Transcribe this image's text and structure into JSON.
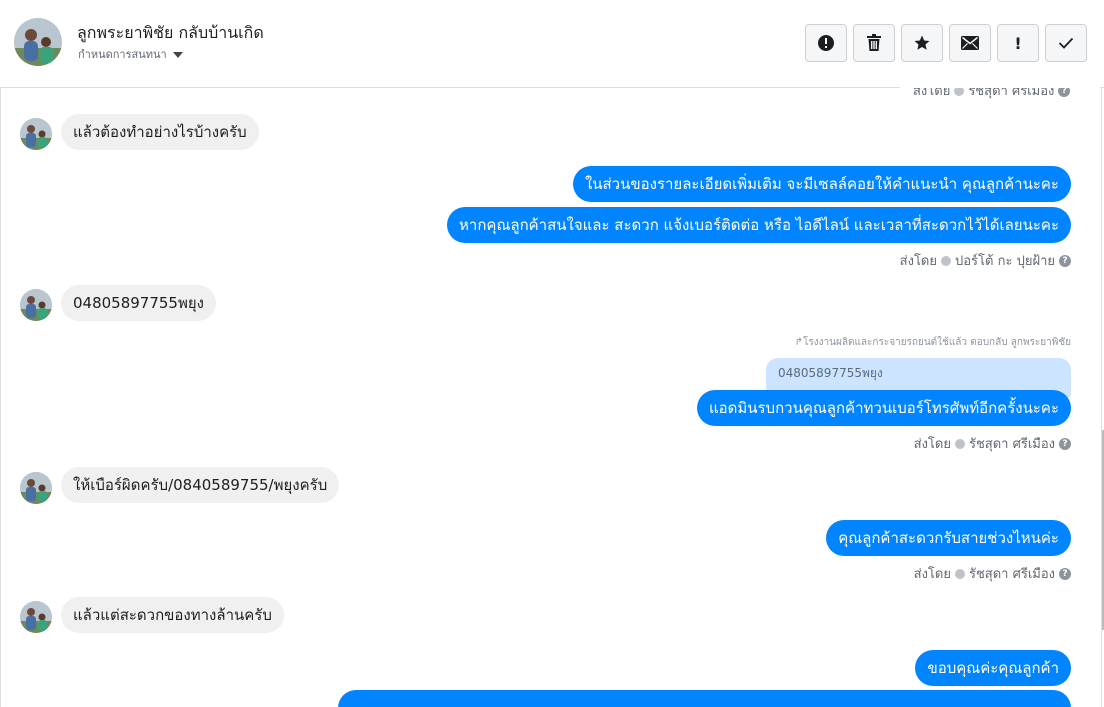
{
  "header": {
    "contact_name": "ลูกพระยาพิชัย กลับบ้านเกิด",
    "assign_label": "กำหนดการสนทนา",
    "actions": [
      {
        "name": "spam-button",
        "icon": "alert-circle-icon"
      },
      {
        "name": "delete-button",
        "icon": "trash-icon"
      },
      {
        "name": "star-button",
        "icon": "star-icon"
      },
      {
        "name": "mark-unread-button",
        "icon": "envelope-icon"
      },
      {
        "name": "follow-up-button",
        "icon": "exclamation-icon"
      },
      {
        "name": "done-button",
        "icon": "checkmark-icon"
      }
    ]
  },
  "messages": {
    "top_sent_by_partial": "ส่งโดย",
    "top_sender_partial": "รัชสุดา ศรีเมือง",
    "m1": "แล้วต้องทำอย่างไรบ้างครับ",
    "m2": "ในส่วนของรายละเอียดเพิ่มเติม จะมีเซลล์คอยให้คำแนะนำ คุณลูกค้านะคะ",
    "m3": "หากคุณลูกค้าสนใจและ สะดวก แจ้งเบอร์ติดต่อ หรือ ไอดีไลน์ และเวลาที่สะดวกไว้ได้เลยนะคะ",
    "sent_by_label": "ส่งโดย",
    "sender_a": "ปอร์โต้ กะ ปุยฝ้าย",
    "m4": "04805897755พยุง",
    "reply_note": "โรงงานผลิตและกระจายรถยนต์ใช้แล้ว ตอบกลับ ลูกพระยาพิชัย",
    "quoted_text": "04805897755พยุง",
    "m5": "แอดมินรบกวนคุณลูกค้าทวนเบอร์โทรศัพท์อีกครั้งนะคะ",
    "sender_b": "รัชสุดา ศรีเมือง",
    "m6": "ให้เบือร์ผิดครับ/0840589755/พยุงครับ",
    "m7": "คุณลูกค้าสะดวกรับสายช่วงไหนค่ะ",
    "m8": "แล้วแต่สะดวกของทางล้านครับ",
    "m9": "ขอบคุณค่ะคุณลูกค้า"
  },
  "colors": {
    "outgoing_bubble": "#0084ff",
    "incoming_bubble": "#f0f0f0",
    "quoted_bubble": "#cce4ff"
  }
}
